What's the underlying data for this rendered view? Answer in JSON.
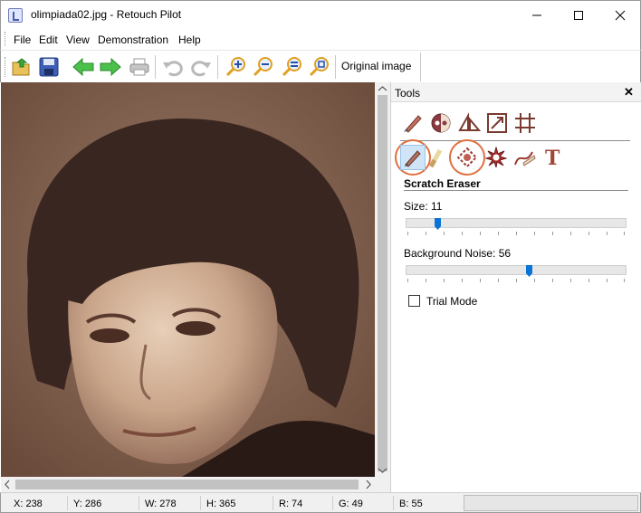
{
  "window": {
    "title": "olimpiada02.jpg - Retouch Pilot",
    "minimize_icon": "minimize-icon",
    "maximize_icon": "maximize-icon",
    "close_icon": "close-icon"
  },
  "menu": {
    "items": [
      "File",
      "Edit",
      "View",
      "Demonstration",
      "Help"
    ]
  },
  "toolbar": {
    "icons": [
      "open-icon",
      "save-icon",
      "back-arrow-icon",
      "forward-arrow-icon",
      "print-icon",
      "undo-icon",
      "redo-icon",
      "zoom-in-icon",
      "zoom-out-icon",
      "zoom-fit-icon",
      "zoom-actual-icon"
    ],
    "original_image_label": "Original image"
  },
  "tools_panel": {
    "title": "Tools",
    "close": "✕",
    "selected_tool": "Scratch Eraser",
    "size_label": "Size: 11",
    "size_value": 11,
    "noise_label": "Background Noise: 56",
    "noise_value": 56,
    "trial_mode_label": "Trial Mode",
    "trial_mode_checked": false
  },
  "statusbar": {
    "x": "X: 238",
    "y": "Y: 286",
    "w": "W: 278",
    "h": "H: 365",
    "r": "R: 74",
    "g": "G: 49",
    "b": "B: 55"
  }
}
